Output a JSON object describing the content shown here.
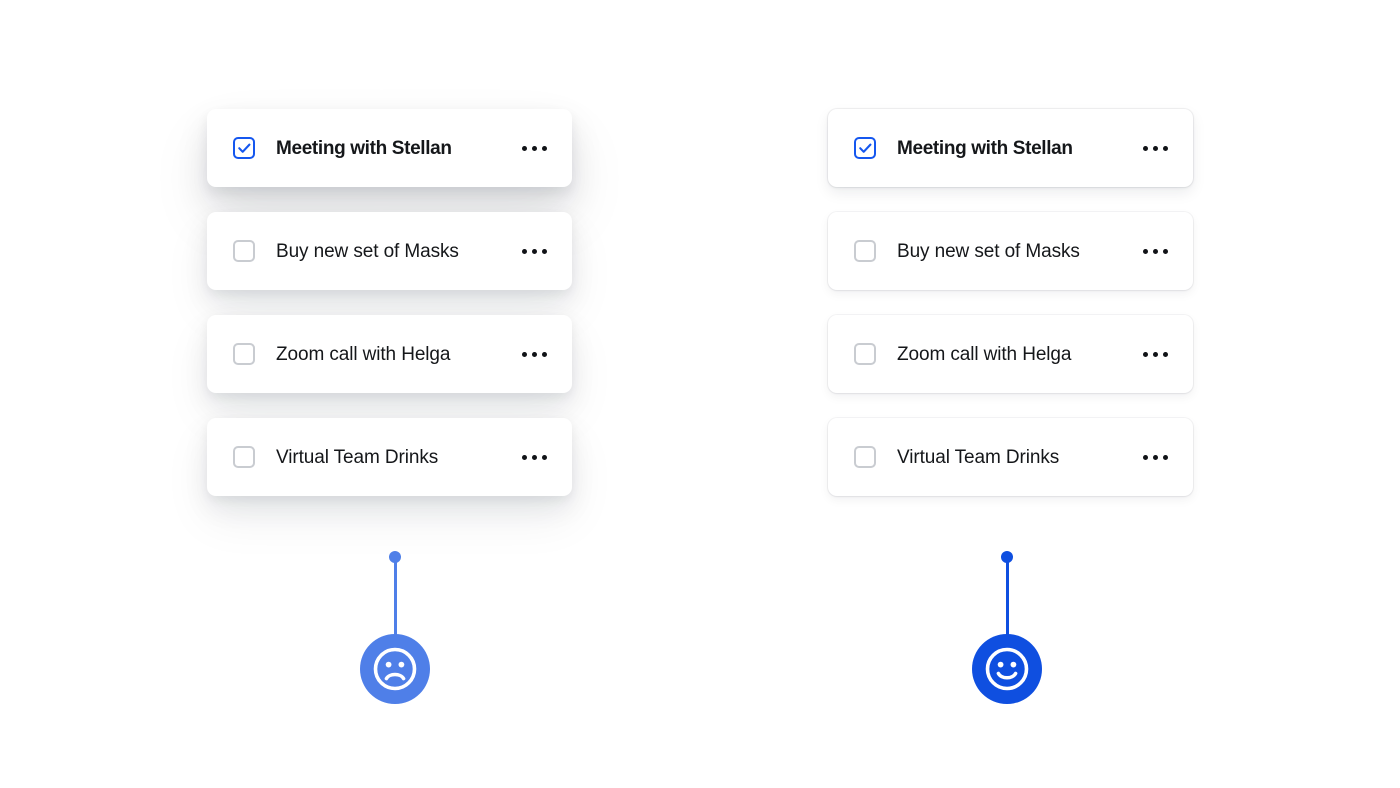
{
  "page": {
    "title": "Todo card shadow style comparison",
    "background_color": "#ffffff"
  },
  "panels": [
    {
      "id": "left",
      "name": "soft-diffuse-shadow-variant",
      "accent_color": "#4f7fe8",
      "card_background": "#ffffff",
      "shadow_style": "large soft diffuse drop shadow, no border",
      "marker": {
        "icon": "frowning-face-icon",
        "sentiment": "negative",
        "pin_color": "#4f7fe8"
      },
      "todos": [
        {
          "label": "Meeting with Stellan",
          "checked": true,
          "emphasis": true,
          "checkbox_icon": "checkbox-checked-icon",
          "menu_icon": "kebab-menu-icon"
        },
        {
          "label": "Buy new set of Masks",
          "checked": false,
          "emphasis": false,
          "checkbox_icon": "checkbox-unchecked-icon",
          "menu_icon": "kebab-menu-icon"
        },
        {
          "label": "Zoom call with Helga",
          "checked": false,
          "emphasis": false,
          "checkbox_icon": "checkbox-unchecked-icon",
          "menu_icon": "kebab-menu-icon"
        },
        {
          "label": "Virtual Team Drinks",
          "checked": false,
          "emphasis": false,
          "checkbox_icon": "checkbox-unchecked-icon",
          "menu_icon": "kebab-menu-icon"
        }
      ]
    },
    {
      "id": "right",
      "name": "tight-crisp-shadow-variant",
      "accent_color": "#0f4fe0",
      "card_background": "#ffffff",
      "shadow_style": "tight crisp shadow with hairline border",
      "marker": {
        "icon": "smiling-face-icon",
        "sentiment": "positive",
        "pin_color": "#0f4fe0"
      },
      "todos": [
        {
          "label": "Meeting with Stellan",
          "checked": true,
          "emphasis": true,
          "checkbox_icon": "checkbox-checked-icon",
          "menu_icon": "kebab-menu-icon"
        },
        {
          "label": "Buy new set of Masks",
          "checked": false,
          "emphasis": false,
          "checkbox_icon": "checkbox-unchecked-icon",
          "menu_icon": "kebab-menu-icon"
        },
        {
          "label": "Zoom call with Helga",
          "checked": false,
          "emphasis": false,
          "checkbox_icon": "checkbox-unchecked-icon",
          "menu_icon": "kebab-menu-icon"
        },
        {
          "label": "Virtual Team Drinks",
          "checked": false,
          "emphasis": false,
          "checkbox_icon": "checkbox-unchecked-icon",
          "menu_icon": "kebab-menu-icon"
        }
      ]
    }
  ]
}
